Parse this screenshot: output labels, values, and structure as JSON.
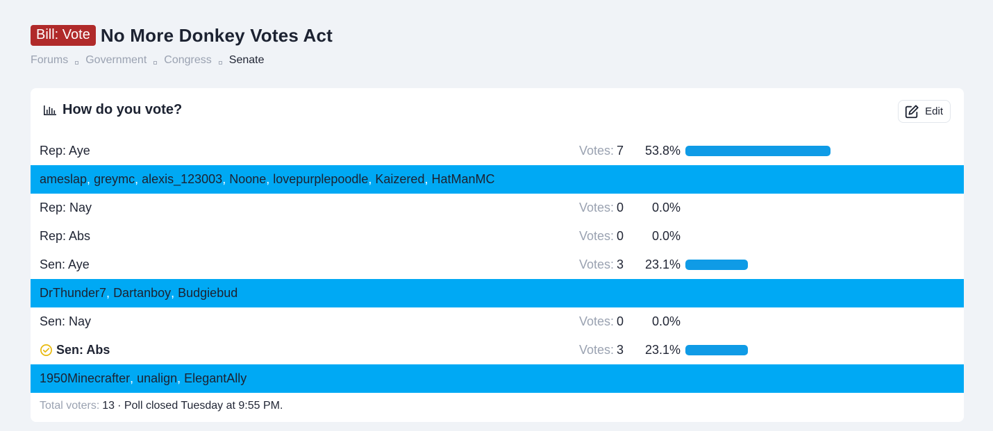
{
  "thread": {
    "prefix": "Bill: Vote",
    "title": "No More Donkey Votes Act"
  },
  "breadcrumb": [
    "Forums",
    "Government",
    "Congress",
    "Senate"
  ],
  "poll": {
    "question": "How do you vote?",
    "edit_label": "Edit",
    "votes_label": "Votes:",
    "options": [
      {
        "label": "Rep: Aye",
        "votes": "7",
        "percent": "53.8%",
        "fraction": 0.538,
        "voters": [
          "ameslap",
          "greymc",
          "alexis_123003",
          "Noone",
          "lovepurplepoodle",
          "Kaizered",
          "HatManMC"
        ]
      },
      {
        "label": "Rep: Nay",
        "votes": "0",
        "percent": "0.0%",
        "fraction": 0,
        "voters": []
      },
      {
        "label": "Rep: Abs",
        "votes": "0",
        "percent": "0.0%",
        "fraction": 0,
        "voters": []
      },
      {
        "label": "Sen: Aye",
        "votes": "3",
        "percent": "23.1%",
        "fraction": 0.231,
        "voters": [
          "DrThunder7",
          "Dartanboy",
          "Budgiebud"
        ]
      },
      {
        "label": "Sen: Nay",
        "votes": "0",
        "percent": "0.0%",
        "fraction": 0,
        "voters": []
      },
      {
        "label": "Sen: Abs",
        "votes": "3",
        "percent": "23.1%",
        "fraction": 0.231,
        "selected": true,
        "voters": [
          "1950Minecrafter",
          "unalign",
          "ElegantAlly"
        ]
      }
    ],
    "footer": {
      "total_label": "Total voters:",
      "total": "13",
      "status": "· Poll closed Tuesday at 9:55 PM."
    }
  },
  "colors": {
    "prefix_bg": "#b02a2a",
    "bar": "#0f9be6",
    "voters_bg": "#00a9f4"
  }
}
